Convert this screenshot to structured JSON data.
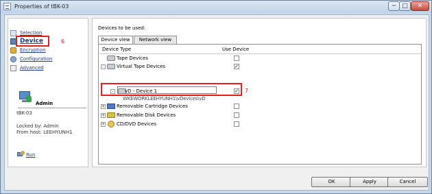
{
  "window": {
    "title": "Properties of tBK-03"
  },
  "window_buttons": {
    "minimize": "─",
    "maximize": "□",
    "close": "✕"
  },
  "sidebar": {
    "items": [
      {
        "label": "Selection",
        "icon": "selection-icon"
      },
      {
        "label": "Device",
        "icon": "device-icon",
        "selected": true
      },
      {
        "label": "Encryption",
        "icon": "lock-icon"
      },
      {
        "label": "Configuration",
        "icon": "configuration-icon"
      },
      {
        "label": "Advanced",
        "icon": "advanced-icon"
      }
    ],
    "annotation": "6"
  },
  "admin": {
    "name": "Admin",
    "host": "tBK-03",
    "locked_by": "Locked by: Admin",
    "from_host": "From host: LEEHYUNH1",
    "run_label": "Run"
  },
  "main": {
    "devices_label": "Devices to be used:",
    "tabs": [
      {
        "label": "Device view",
        "active": true
      },
      {
        "label": "Network view",
        "active": false
      }
    ],
    "columns": {
      "device_type": "Device Type",
      "use_device": "Use Device"
    },
    "rows": [
      {
        "name": "Tape Devices",
        "icon": "tape-icon",
        "expander": "",
        "checked": false
      },
      {
        "name": "Virtual Tape Devices",
        "icon": "tape-icon",
        "expander": "-",
        "checked": true
      },
      {
        "name": "vD - Device 1",
        "icon": "tape-icon",
        "expander": "-",
        "checked": true
      },
      {
        "name": "Removable Cartridge Devices",
        "icon": "cartridge-icon",
        "expander": "+",
        "checked": false
      },
      {
        "name": "Removable Disk Devices",
        "icon": "disk-icon",
        "expander": "+",
        "checked": false
      },
      {
        "name": "CD/DVD Devices",
        "icon": "cd-icon",
        "expander": "+",
        "checked": false
      }
    ],
    "path_text": "WKEWORKLEEHYUNH1\\vDevices\\vD",
    "check_mark": "✓",
    "annotation": "7"
  },
  "buttons": {
    "ok": "OK",
    "apply": "Apply",
    "cancel": "Cancel"
  },
  "colors": {
    "highlight": "#e02020",
    "link": "#1f3e8a"
  }
}
